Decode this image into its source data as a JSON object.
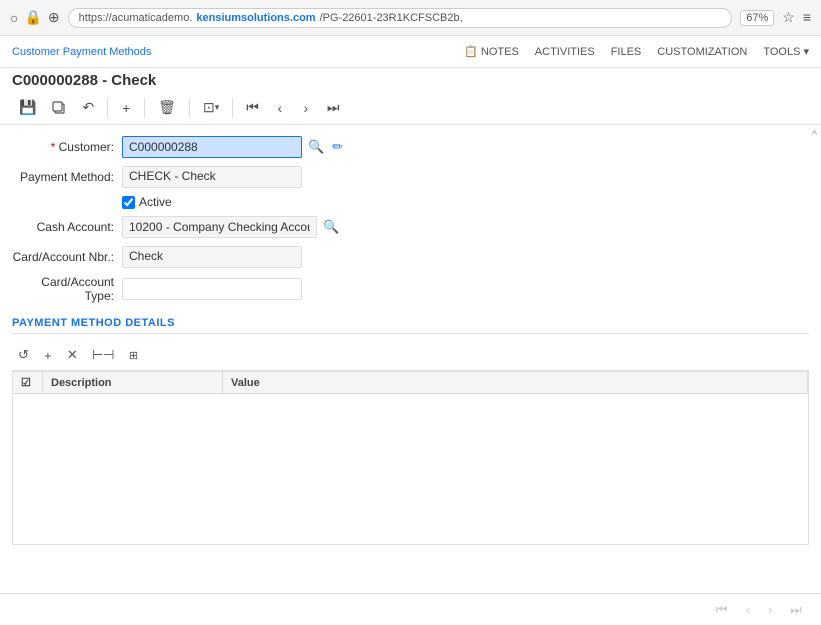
{
  "browser": {
    "url_prefix": "https://acumaticademo.",
    "url_domain": "kensiumsolutions.com",
    "url_path": "/PG-22601-23R1KCFSCB2b,",
    "zoom": "67%",
    "lock_icon": "🔒",
    "site_settings_icon": "⚙",
    "star_icon": "☆",
    "menu_icon": "≡"
  },
  "top_nav": {
    "breadcrumb": "Customer Payment Methods",
    "notes_label": "NOTES",
    "activities_label": "ACTIVITIES",
    "files_label": "FILES",
    "customization_label": "CUSTOMIZATION",
    "tools_label": "TOOLS ▾"
  },
  "page": {
    "title": "C000000288 - Check"
  },
  "toolbar": {
    "save_icon": "💾",
    "copy_icon": "⧉",
    "undo_icon": "↶",
    "add_icon": "+",
    "delete_icon": "🗑",
    "clipboard_icon": "⊡",
    "first_icon": "⏮",
    "prev_icon": "‹",
    "next_icon": "›",
    "last_icon": "⏭"
  },
  "form": {
    "customer_label": "* Customer:",
    "customer_value": "C000000288",
    "customer_placeholder": "C000000288",
    "payment_method_label": "Payment Method:",
    "payment_method_value": "CHECK - Check",
    "active_label": "Active",
    "active_checked": true,
    "cash_account_label": "Cash Account:",
    "cash_account_value": "10200 - Company Checking Accou",
    "card_account_nbr_label": "Card/Account Nbr.:",
    "card_account_nbr_value": "Check",
    "card_account_type_label": "Card/Account Type:",
    "card_account_type_value": ""
  },
  "payment_details_section": {
    "title": "PAYMENT METHOD DETAILS",
    "sub_toolbar": {
      "refresh_icon": "↺",
      "add_icon": "+",
      "delete_icon": "✕",
      "fit_icon": "⊢⊣",
      "export_icon": "⊞"
    },
    "grid": {
      "columns": [
        {
          "id": "selector",
          "label": ""
        },
        {
          "id": "description",
          "label": "Description"
        },
        {
          "id": "value",
          "label": "Value"
        }
      ],
      "rows": []
    }
  },
  "bottom_bar": {
    "first_icon": "⏮",
    "prev_icon": "‹",
    "next_icon": "›",
    "last_icon": "⏭"
  },
  "scroll": {
    "up_arrow": "^"
  }
}
